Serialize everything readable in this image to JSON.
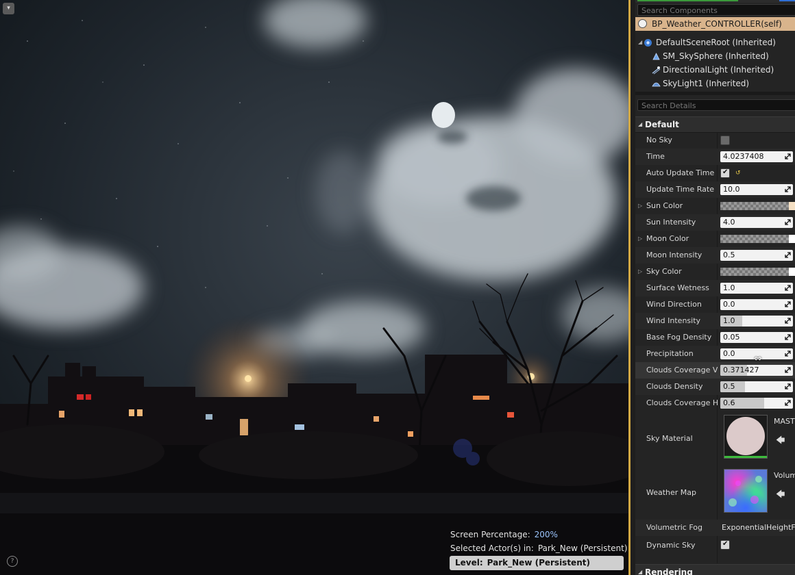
{
  "viewport": {
    "menu_icon": "chevron-down-icon",
    "help_icon": "question-icon",
    "screen_percentage_label": "Screen Percentage:",
    "screen_percentage_value": "200%",
    "selected_actor_label": "Selected Actor(s) in:",
    "selected_actor_value": "Park_New (Persistent)",
    "level_label": "Level:",
    "level_value": "Park_New (Persistent)"
  },
  "components": {
    "search_placeholder": "Search Components",
    "self": "BP_Weather_CONTROLLER(self)",
    "tree": [
      {
        "label": "DefaultSceneRoot (Inherited)",
        "icon": "scene-root-icon",
        "level": 0
      },
      {
        "label": "SM_SkySphere (Inherited)",
        "icon": "static-mesh-icon",
        "level": 1
      },
      {
        "label": "DirectionalLight (Inherited)",
        "icon": "directional-light-icon",
        "level": 1
      },
      {
        "label": "SkyLight1 (Inherited)",
        "icon": "skylight-icon",
        "level": 1
      }
    ]
  },
  "details": {
    "search_placeholder": "Search Details",
    "category_default": "Default",
    "category_rendering": "Rendering",
    "props": {
      "no_sky": {
        "label": "No Sky",
        "checked": false
      },
      "time": {
        "label": "Time",
        "value": "4.0237408"
      },
      "auto_update_time": {
        "label": "Auto Update Time",
        "checked": true
      },
      "update_time_rate": {
        "label": "Update Time Rate",
        "value": "10.0"
      },
      "sun_color": {
        "label": "Sun Color",
        "swatch": "#f5e0c4"
      },
      "sun_intensity": {
        "label": "Sun Intensity",
        "value": "4.0"
      },
      "moon_color": {
        "label": "Moon Color",
        "swatch": "#ffffff"
      },
      "moon_intensity": {
        "label": "Moon Intensity",
        "value": "0.5"
      },
      "sky_color": {
        "label": "Sky Color",
        "swatch": "#ffffff"
      },
      "surface_wetness": {
        "label": "Surface Wetness",
        "value": "1.0"
      },
      "wind_direction": {
        "label": "Wind Direction",
        "value": "0.0"
      },
      "wind_intensity": {
        "label": "Wind Intensity",
        "value": "1.0",
        "fill": 0.3
      },
      "base_fog_density": {
        "label": "Base Fog Density",
        "value": "0.05"
      },
      "precipitation": {
        "label": "Precipitation",
        "value": "0.0"
      },
      "clouds_coverage_vol": {
        "label": "Clouds Coverage Vol",
        "value": "0.371427",
        "fill": 0.37
      },
      "clouds_density": {
        "label": "Clouds Density",
        "value": "0.5",
        "fill": 0.34
      },
      "clouds_coverage_hig": {
        "label": "Clouds Coverage Hig",
        "value": "0.6",
        "fill": 0.6
      },
      "sky_material": {
        "label": "Sky Material",
        "asset": "MAST"
      },
      "weather_map": {
        "label": "Weather Map",
        "asset": "Volum"
      },
      "volumetric_fog": {
        "label": "Volumetric Fog",
        "value": "ExponentialHeightFog"
      },
      "dynamic_sky": {
        "label": "Dynamic Sky",
        "checked": true
      }
    }
  },
  "colors": {
    "accent_splitter": "#d2a843",
    "selection": "#d9b48c",
    "screen_percentage": "#9ec6ff"
  }
}
